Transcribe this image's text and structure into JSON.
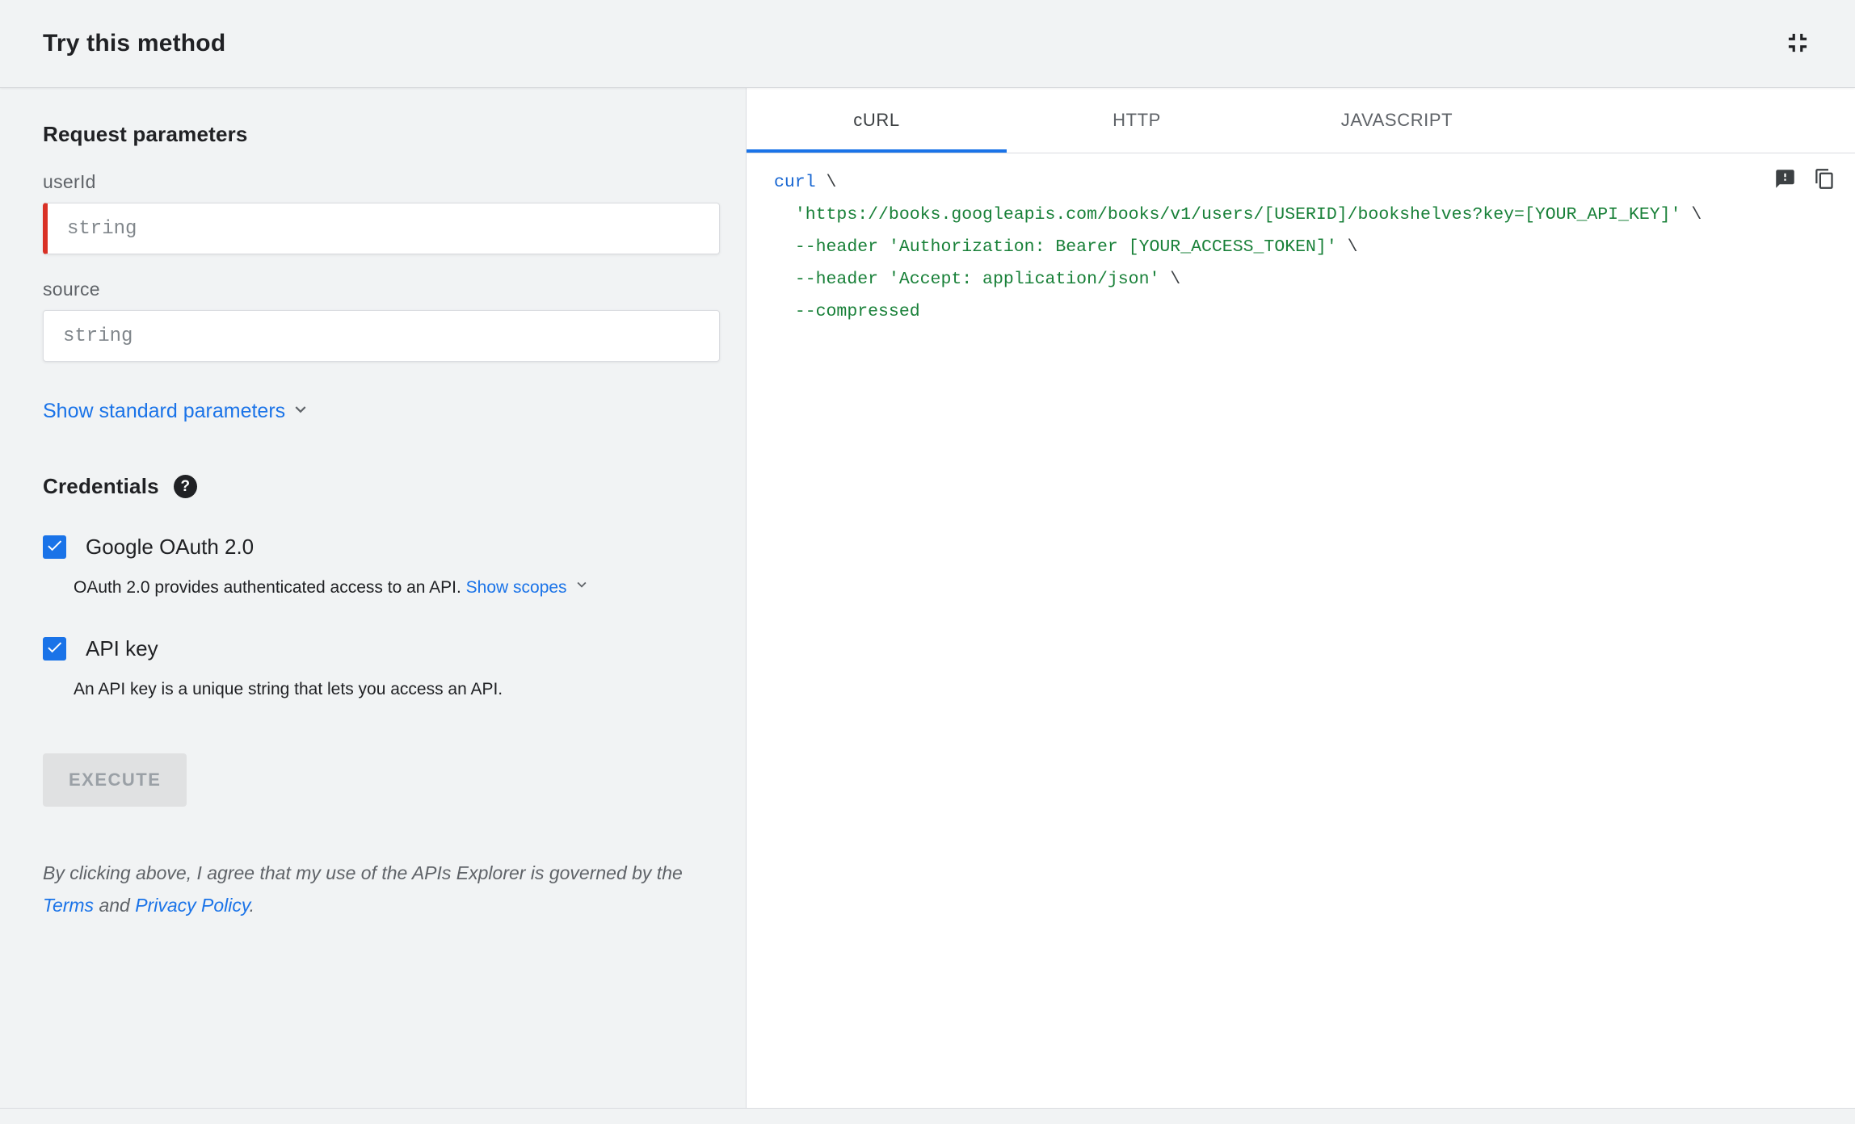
{
  "header": {
    "title": "Try this method"
  },
  "icons": {
    "help_glyph": "?"
  },
  "params": {
    "section_title": "Request parameters",
    "fields": [
      {
        "label": "userId",
        "placeholder": "string",
        "required": true
      },
      {
        "label": "source",
        "placeholder": "string",
        "required": false
      }
    ],
    "show_standard_label": "Show standard parameters"
  },
  "credentials": {
    "section_title": "Credentials",
    "oauth": {
      "label": "Google OAuth 2.0",
      "checked": true,
      "description": "OAuth 2.0 provides authenticated access to an API.",
      "show_scopes_label": "Show scopes"
    },
    "api_key": {
      "label": "API key",
      "checked": true,
      "description": "An API key is a unique string that lets you access an API."
    }
  },
  "execute": {
    "label": "EXECUTE"
  },
  "disclaimer": {
    "text_before": "By clicking above, I agree that my use of the APIs Explorer is governed by the ",
    "terms_link": "Terms",
    "text_mid": " and ",
    "privacy_link": "Privacy Policy",
    "text_after": "."
  },
  "tabs": [
    {
      "label": "cURL",
      "active": true
    },
    {
      "label": "HTTP",
      "active": false
    },
    {
      "label": "JAVASCRIPT",
      "active": false
    }
  ],
  "code": {
    "language": "curl",
    "lines": [
      [
        {
          "t": "curl",
          "c": "kw"
        },
        {
          "t": " \\",
          "c": "pln"
        }
      ],
      [
        {
          "t": "  ",
          "c": "pln"
        },
        {
          "t": "'https://books.googleapis.com/books/v1/users/[USERID]/bookshelves?key=[YOUR_API_KEY]'",
          "c": "str"
        },
        {
          "t": " \\",
          "c": "pln"
        }
      ],
      [
        {
          "t": "  ",
          "c": "pln"
        },
        {
          "t": "--header ",
          "c": "flag"
        },
        {
          "t": "'Authorization: Bearer [YOUR_ACCESS_TOKEN]'",
          "c": "str"
        },
        {
          "t": " \\",
          "c": "pln"
        }
      ],
      [
        {
          "t": "  ",
          "c": "pln"
        },
        {
          "t": "--header ",
          "c": "flag"
        },
        {
          "t": "'Accept: application/json'",
          "c": "str"
        },
        {
          "t": " \\",
          "c": "pln"
        }
      ],
      [
        {
          "t": "  ",
          "c": "pln"
        },
        {
          "t": "--compressed",
          "c": "flag"
        }
      ]
    ]
  },
  "colors": {
    "accent_blue": "#1a73e8",
    "required_red": "#d93025",
    "panel_gray": "#f1f3f4",
    "border_gray": "#dadce0",
    "code_keyword": "#1967d2",
    "code_string": "#188038",
    "disabled_button_bg": "#e0e1e2",
    "disabled_button_text": "#9aa0a6"
  }
}
